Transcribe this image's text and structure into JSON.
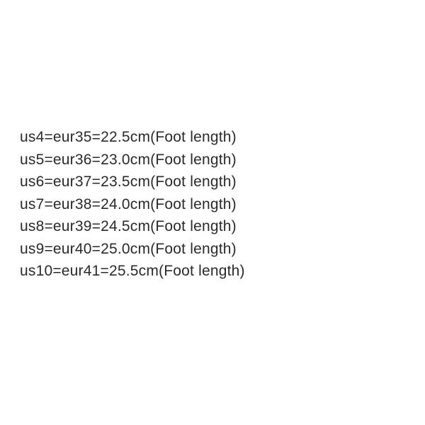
{
  "size_chart": {
    "rows": [
      {
        "us": "us4",
        "eur": "eur35",
        "cm": "22.5cm",
        "label": "(Foot length)"
      },
      {
        "us": "us5",
        "eur": "eur36",
        "cm": "23.0cm",
        "label": "(Foot length)"
      },
      {
        "us": "us6",
        "eur": "eur37",
        "cm": "23.5cm",
        "label": "(Foot length)"
      },
      {
        "us": "us7",
        "eur": "eur38",
        "cm": "24.0cm",
        "label": "(Foot length)"
      },
      {
        "us": "us8",
        "eur": "eur39",
        "cm": "24.5cm",
        "label": "(Foot length)"
      },
      {
        "us": "us9",
        "eur": "eur40",
        "cm": "25.0cm",
        "label": "(Foot length)"
      },
      {
        "us": "us10",
        "eur": "eur41",
        "cm": "25.5cm",
        "label": "(Foot length)"
      }
    ]
  }
}
